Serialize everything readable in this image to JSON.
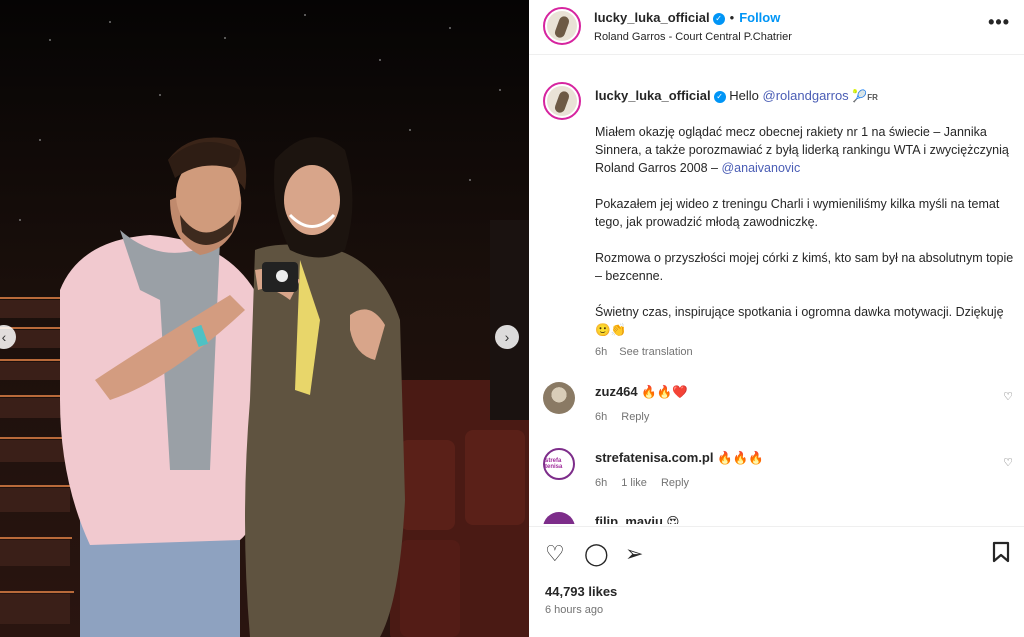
{
  "post": {
    "username": "lucky_luka_official",
    "follow_label": "Follow",
    "location": "Roland Garros - Court Central P.Chatrier",
    "more_label": "•••"
  },
  "caption": {
    "username": "lucky_luka_official",
    "greeting": "Hello",
    "mention": "@rolandgarros",
    "lang_tag": "FR",
    "paragraphs": [
      "Miałem okazję oglądać mecz obecnej rakiety nr 1 na świecie – Jannika Sinnera, a także porozmawiać z byłą liderką rankingu WTA i zwyciężczynią Roland Garros 2008 –",
      "Pokazałem jej wideo z treningu Charli i wymieniliśmy kilka myśli na temat tego, jak prowadzić młodą zawodniczkę.",
      "Rozmowa o przyszłości mojej córki z kimś, kto sam był na absolutnym topie – bezcenne.",
      "Świetny czas, inspirujące spotkania i ogromna dawka motywacji. Dziękuję"
    ],
    "mention2": "@anaivanovic",
    "emoji_end": "🙂👏",
    "time": "6h",
    "translate": "See translation"
  },
  "comments": [
    {
      "username": "zuz464",
      "text": "🔥🔥❤️",
      "time": "6h",
      "reply": "Reply",
      "likes": ""
    },
    {
      "username": "strefatenisa.com.pl",
      "text": "🔥🔥🔥",
      "time": "6h",
      "likes": "1 like",
      "reply": "Reply",
      "avatar_text": "strefa tenisa"
    },
    {
      "username": "filip_maviu",
      "text": "😍"
    }
  ],
  "footer": {
    "likes": "44,793 likes",
    "time": "6 hours ago"
  },
  "colors": {
    "accent": "#0095f6",
    "mention": "#4a5db5",
    "story_ring": "#d6249f"
  },
  "icons": [
    "verified-icon",
    "more-icon",
    "heart-icon",
    "comment-icon",
    "share-icon",
    "bookmark-icon",
    "chevron-left-icon",
    "chevron-right-icon",
    "tennis-racket-icon"
  ]
}
